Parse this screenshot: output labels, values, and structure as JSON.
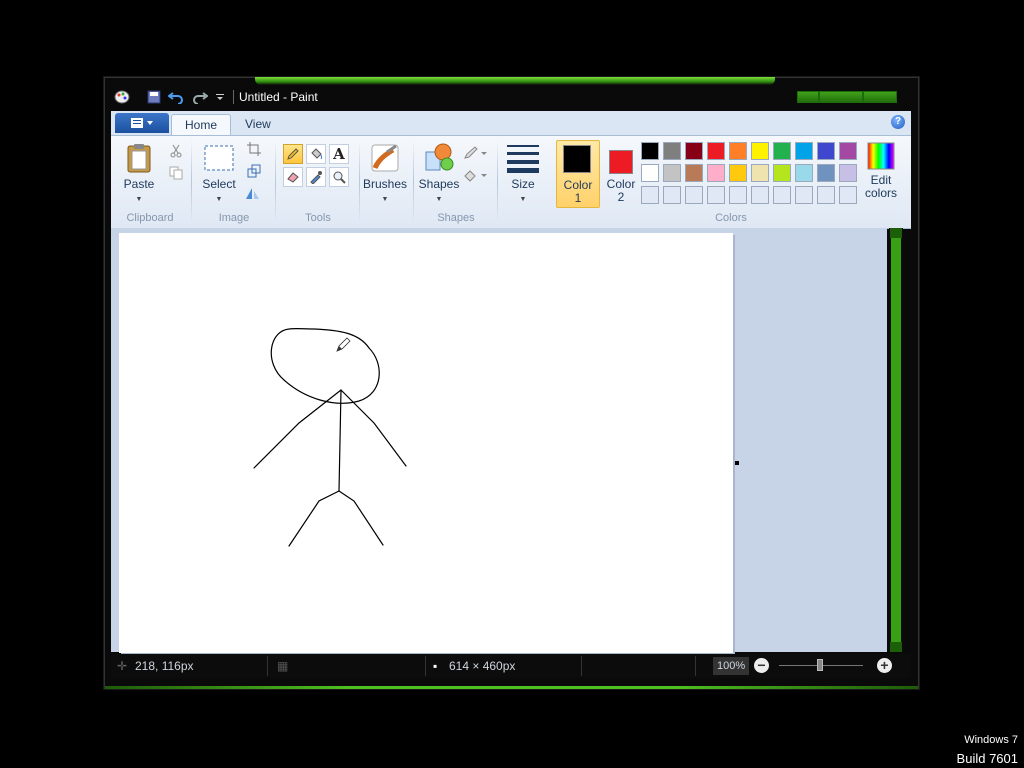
{
  "window": {
    "title": "Untitled - Paint"
  },
  "tabs": [
    {
      "label": "Home",
      "active": true
    },
    {
      "label": "View",
      "active": false
    }
  ],
  "ribbon": {
    "clipboard": {
      "paste_label": "Paste",
      "group_label": "Clipboard"
    },
    "image": {
      "select_label": "Select",
      "group_label": "Image"
    },
    "tools": {
      "group_label": "Tools"
    },
    "brushes": {
      "label": "Brushes"
    },
    "shapes": {
      "label": "Shapes",
      "group_label": "Shapes"
    },
    "size": {
      "label": "Size"
    },
    "colors": {
      "color1_label": "Color",
      "color1_num": "1",
      "color2_label": "Color",
      "color2_num": "2",
      "edit_label": "Edit",
      "edit_label2": "colors",
      "group_label": "Colors",
      "color1": "#000000",
      "color2": "#ed1c24",
      "palette_row1": [
        "#000000",
        "#7f7f7f",
        "#880015",
        "#ed1c24",
        "#ff7f27",
        "#fff200",
        "#22b14c",
        "#00a2e8",
        "#3f48cc",
        "#a349a4"
      ],
      "palette_row2": [
        "#ffffff",
        "#c3c3c3",
        "#b97a57",
        "#ffaec9",
        "#ffc90e",
        "#efe4b0",
        "#b5e61d",
        "#99d9ea",
        "#7092be",
        "#c8bfe7"
      ],
      "palette_row3": [
        "#dfe8f4",
        "#dfe8f4",
        "#dfe8f4",
        "#dfe8f4",
        "#dfe8f4",
        "#dfe8f4",
        "#dfe8f4",
        "#dfe8f4",
        "#dfe8f4",
        "#dfe8f4"
      ]
    }
  },
  "status": {
    "cursor_pos": "218, 116px",
    "canvas_size": "614 × 460px",
    "zoom": "100%"
  },
  "watermark": {
    "line1": "Windows 7",
    "line2": "Build 7601"
  }
}
